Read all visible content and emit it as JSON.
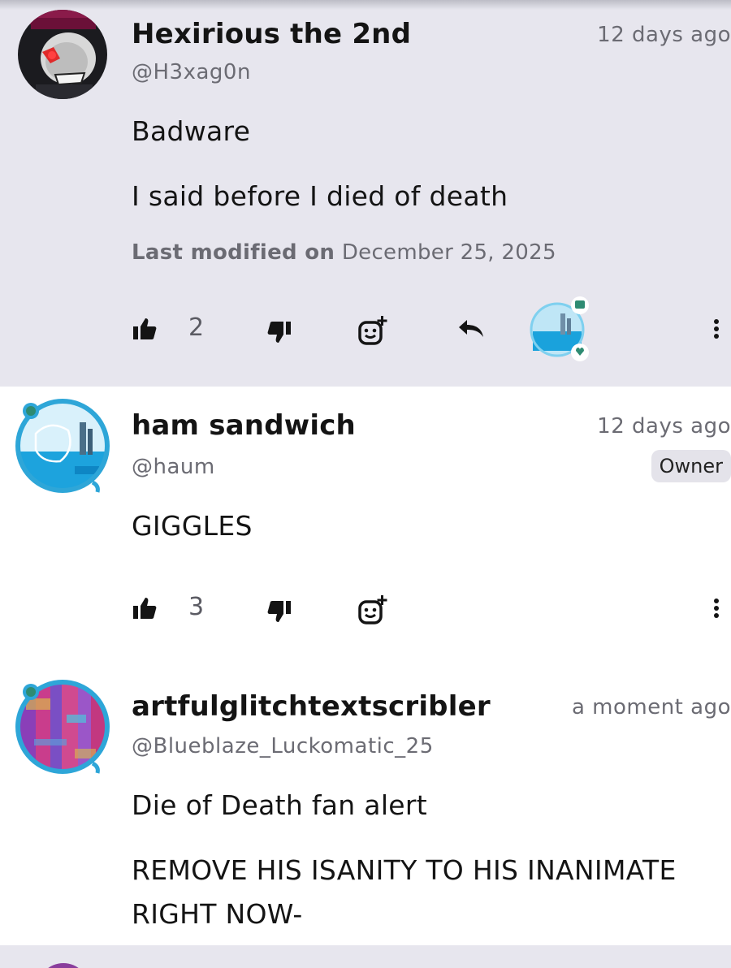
{
  "comments": [
    {
      "display_name": "Hexirious the 2nd",
      "handle": "@H3xag0n",
      "time": "12 days ago",
      "lines": [
        "Badware",
        "I said before I died of death"
      ],
      "modified_label": "Last modified on",
      "modified_date": "December 25, 2025",
      "likes": "2",
      "icons": [
        "thumbs-up-icon",
        "thumbs-down-icon",
        "add-reaction-icon",
        "reply-icon",
        "reacted-by-avatar",
        "more-options-icon"
      ]
    },
    {
      "display_name": "ham sandwich",
      "handle": "@haum",
      "time": "12 days ago",
      "role_badge": "Owner",
      "lines": [
        "GIGGLES"
      ],
      "likes": "3",
      "icons": [
        "thumbs-up-icon",
        "thumbs-down-icon",
        "add-reaction-icon",
        "more-options-icon"
      ]
    },
    {
      "display_name": "artfulglitchtextscribler",
      "handle": "@Blueblaze_Luckomatic_25",
      "time": "a moment ago",
      "lines": [
        "Die of Death fan alert",
        "REMOVE HIS ISANITY TO HIS INANIMATE",
        "RIGHT NOW-"
      ]
    }
  ],
  "colors": {
    "highlight_bg": "#e7e6ee",
    "muted_text": "#6b6b73",
    "badge_teal": "#2e8b72",
    "ring_blue": "#2ea6d8"
  }
}
